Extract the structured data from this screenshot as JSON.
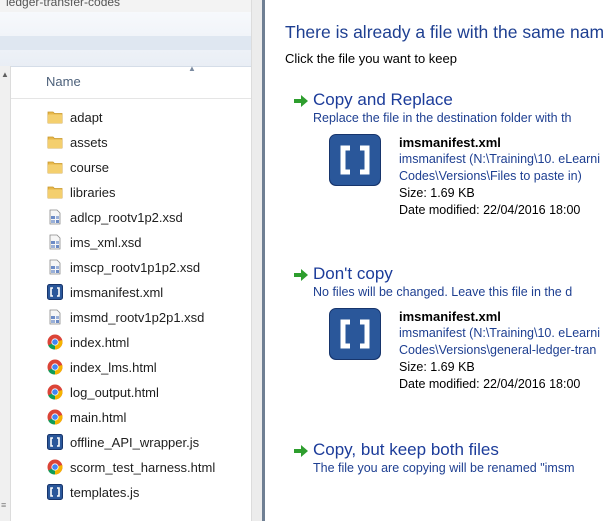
{
  "explorer": {
    "path_fragment": "ledger-transfer-codes",
    "column_header": "Name",
    "files": [
      {
        "name": "adapt",
        "icon": "folder-icon"
      },
      {
        "name": "assets",
        "icon": "folder-icon"
      },
      {
        "name": "course",
        "icon": "folder-icon"
      },
      {
        "name": "libraries",
        "icon": "folder-icon"
      },
      {
        "name": "adlcp_rootv1p2.xsd",
        "icon": "xsd-file-icon"
      },
      {
        "name": "ims_xml.xsd",
        "icon": "xsd-file-icon"
      },
      {
        "name": "imscp_rootv1p1p2.xsd",
        "icon": "xsd-file-icon"
      },
      {
        "name": "imsmanifest.xml",
        "icon": "brackets-file-icon"
      },
      {
        "name": "imsmd_rootv1p2p1.xsd",
        "icon": "xsd-file-icon"
      },
      {
        "name": "index.html",
        "icon": "chrome-icon"
      },
      {
        "name": "index_lms.html",
        "icon": "chrome-icon"
      },
      {
        "name": "log_output.html",
        "icon": "chrome-icon"
      },
      {
        "name": "main.html",
        "icon": "chrome-icon"
      },
      {
        "name": "offline_API_wrapper.js",
        "icon": "brackets-file-icon"
      },
      {
        "name": "scorm_test_harness.html",
        "icon": "chrome-icon"
      },
      {
        "name": "templates.js",
        "icon": "brackets-file-icon"
      }
    ]
  },
  "dialog": {
    "title": "There is already a file with the same nam",
    "subtitle": "Click the file you want to keep",
    "options": [
      {
        "title": "Copy and Replace",
        "description": "Replace the file in the destination folder with th",
        "file": {
          "name": "imsmanifest.xml",
          "path_line1": "imsmanifest (N:\\Training\\10. eLearni",
          "path_line2": "Codes\\Versions\\Files to paste in)",
          "size": "Size: 1.69 KB",
          "modified": "Date modified: 22/04/2016 18:00"
        }
      },
      {
        "title": "Don't copy",
        "description": "No files will be changed. Leave this file in the d",
        "file": {
          "name": "imsmanifest.xml",
          "path_line1": "imsmanifest (N:\\Training\\10. eLearni",
          "path_line2": "Codes\\Versions\\general-ledger-tran",
          "size": "Size: 1.69 KB",
          "modified": "Date modified: 22/04/2016 18:00"
        }
      },
      {
        "title": "Copy, but keep both files",
        "description": "The file you are copying will be renamed \"imsm"
      }
    ]
  },
  "colors": {
    "dialog_title": "#1e3f91",
    "option_title": "#1c3c9a",
    "arrow_green": "#2e9e2e",
    "folder": "#e8b84a",
    "brackets_blue": "#2a579a"
  }
}
